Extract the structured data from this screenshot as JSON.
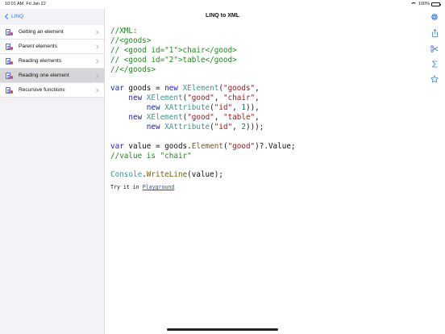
{
  "status_bar": {
    "time": "10:01 AM",
    "date": "Fri Jan 22",
    "battery": "100%"
  },
  "sidebar": {
    "back_label": "LINQ",
    "items": [
      {
        "label": "Getting an element",
        "selected": false
      },
      {
        "label": "Parent elements",
        "selected": false
      },
      {
        "label": "Reading elements",
        "selected": false
      },
      {
        "label": "Reading one element",
        "selected": true
      },
      {
        "label": "Recursive functions",
        "selected": false
      }
    ]
  },
  "main": {
    "title": "LINQ to XML",
    "code_lines": [
      [
        {
          "t": "//XML:",
          "c": "cm"
        }
      ],
      [
        {
          "t": "//<goods>",
          "c": "cm"
        }
      ],
      [
        {
          "t": "// <good id=\"1\">chair</good>",
          "c": "cm"
        }
      ],
      [
        {
          "t": "// <good id=\"2\">table</good>",
          "c": "cm"
        }
      ],
      [
        {
          "t": "//</goods>",
          "c": "cm"
        }
      ],
      [],
      [
        {
          "t": "var",
          "c": "kw"
        },
        {
          "t": " goods = "
        },
        {
          "t": "new",
          "c": "kw"
        },
        {
          "t": " "
        },
        {
          "t": "XElement",
          "c": "ty"
        },
        {
          "t": "("
        },
        {
          "t": "\"goods\"",
          "c": "st"
        },
        {
          "t": ","
        }
      ],
      [
        {
          "t": "    "
        },
        {
          "t": "new",
          "c": "kw"
        },
        {
          "t": " "
        },
        {
          "t": "XElement",
          "c": "ty"
        },
        {
          "t": "("
        },
        {
          "t": "\"good\"",
          "c": "st"
        },
        {
          "t": ", "
        },
        {
          "t": "\"chair\"",
          "c": "st"
        },
        {
          "t": ","
        }
      ],
      [
        {
          "t": "        "
        },
        {
          "t": "new",
          "c": "kw"
        },
        {
          "t": " "
        },
        {
          "t": "XAttribute",
          "c": "ty"
        },
        {
          "t": "("
        },
        {
          "t": "\"id\"",
          "c": "st"
        },
        {
          "t": ", "
        },
        {
          "t": "1",
          "c": "nu"
        },
        {
          "t": ")),"
        }
      ],
      [
        {
          "t": "    "
        },
        {
          "t": "new",
          "c": "kw"
        },
        {
          "t": " "
        },
        {
          "t": "XElement",
          "c": "ty"
        },
        {
          "t": "("
        },
        {
          "t": "\"good\"",
          "c": "st"
        },
        {
          "t": ", "
        },
        {
          "t": "\"table\"",
          "c": "st"
        },
        {
          "t": ","
        }
      ],
      [
        {
          "t": "        "
        },
        {
          "t": "new",
          "c": "kw"
        },
        {
          "t": " "
        },
        {
          "t": "XAttribute",
          "c": "ty"
        },
        {
          "t": "("
        },
        {
          "t": "\"id\"",
          "c": "st"
        },
        {
          "t": ", "
        },
        {
          "t": "2",
          "c": "nu"
        },
        {
          "t": ")));"
        }
      ],
      [],
      [
        {
          "t": "var",
          "c": "kw"
        },
        {
          "t": " value = goods."
        },
        {
          "t": "Element",
          "c": "mt"
        },
        {
          "t": "("
        },
        {
          "t": "\"good\"",
          "c": "st"
        },
        {
          "t": ")?.Value;"
        }
      ],
      [
        {
          "t": "//value is \"chair\"",
          "c": "cm"
        }
      ],
      [],
      [
        {
          "t": "Console",
          "c": "ty"
        },
        {
          "t": "."
        },
        {
          "t": "WriteLine",
          "c": "mt"
        },
        {
          "t": "(value);"
        }
      ]
    ],
    "try_prefix": "Try it in ",
    "try_link": "Playground"
  },
  "icons": {
    "share": "share-icon",
    "scissors": "scissors-icon",
    "sigma": "sigma-icon",
    "star": "star-icon",
    "settings": "gear-icon"
  },
  "colors": {
    "accent": "#2f7ef0",
    "comment": "#1f8a1f",
    "keyword": "#1a1ac8",
    "type": "#3a9a8e",
    "string": "#a31515",
    "selected_row": "#d6d6da"
  }
}
